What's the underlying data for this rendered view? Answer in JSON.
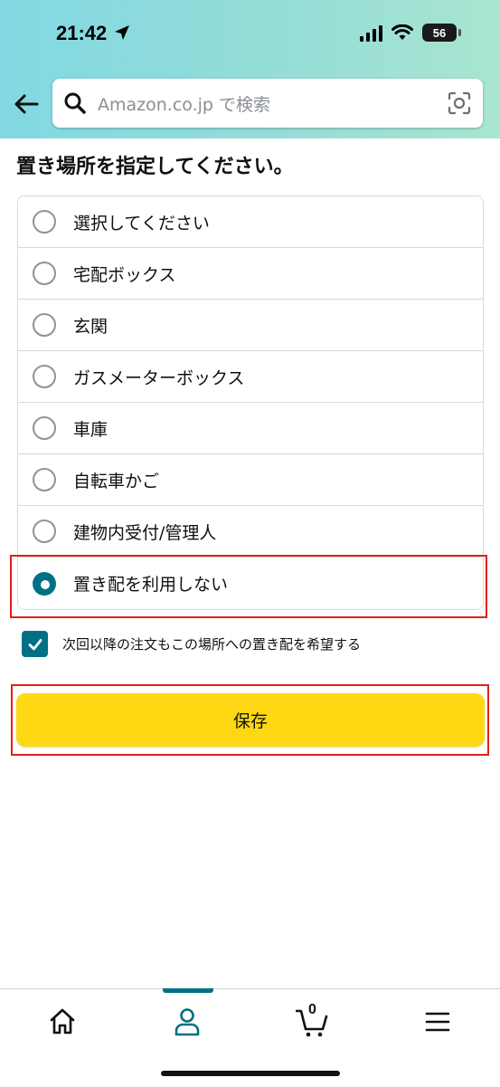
{
  "status_bar": {
    "time": "21:42",
    "battery": "56"
  },
  "search": {
    "placeholder": "Amazon.co.jp で検索"
  },
  "page": {
    "title": "置き場所を指定してください。"
  },
  "options": [
    {
      "label": "選択してください",
      "selected": false
    },
    {
      "label": "宅配ボックス",
      "selected": false
    },
    {
      "label": "玄関",
      "selected": false
    },
    {
      "label": "ガスメーターボックス",
      "selected": false
    },
    {
      "label": "車庫",
      "selected": false
    },
    {
      "label": "自転車かご",
      "selected": false
    },
    {
      "label": "建物内受付/管理人",
      "selected": false
    },
    {
      "label": "置き配を利用しない",
      "selected": true
    }
  ],
  "checkbox": {
    "label": "次回以降の注文もこの場所への置き配を希望する",
    "checked": true
  },
  "save": {
    "label": "保存"
  },
  "nav": {
    "cart_count": "0",
    "active_tab": "account"
  },
  "colors": {
    "accent": "#007185",
    "button": "#ffd814",
    "highlight": "#e0201c"
  }
}
